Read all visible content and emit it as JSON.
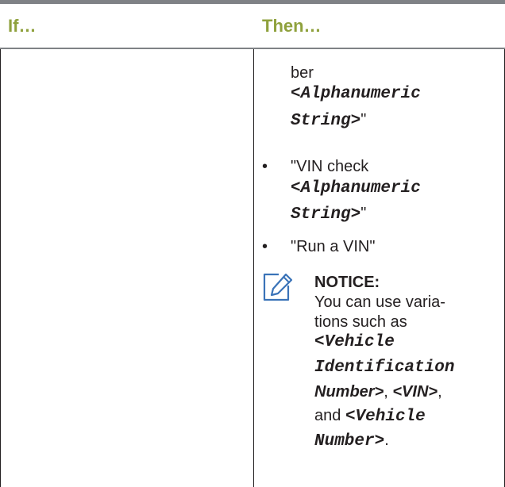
{
  "header": {
    "if_label": "If…",
    "then_label": "Then…"
  },
  "then_cell": {
    "continuation": {
      "line1": "ber",
      "string_line1": "<Alphanumeric",
      "string_line2": "String>",
      "closing_quote": "\""
    },
    "bullets": [
      {
        "bullet": "•",
        "line1": "\"VIN check",
        "string_line1": "<Alphanumeric",
        "string_line2": "String>",
        "closing_quote": "\""
      },
      {
        "bullet": "•",
        "line1": "\"Run a VIN\""
      }
    ],
    "notice": {
      "icon": "note-pencil-icon",
      "title": "NOTICE:",
      "line1": "You can use varia-",
      "line2": "tions such as",
      "var1_line1": "<Vehicle",
      "var1_line2": "Identification",
      "var1_line3": "Number>",
      "sep1": ",",
      "var2": "<VIN>",
      "sep2": ",",
      "and_text": "and",
      "var3_line1": "<Vehicle",
      "var3_line2": "Number>",
      "end": "."
    }
  },
  "colors": {
    "header_text": "#8fa13d",
    "rule": "#7f8286",
    "text": "#231f20",
    "icon": "#3a73b8"
  }
}
